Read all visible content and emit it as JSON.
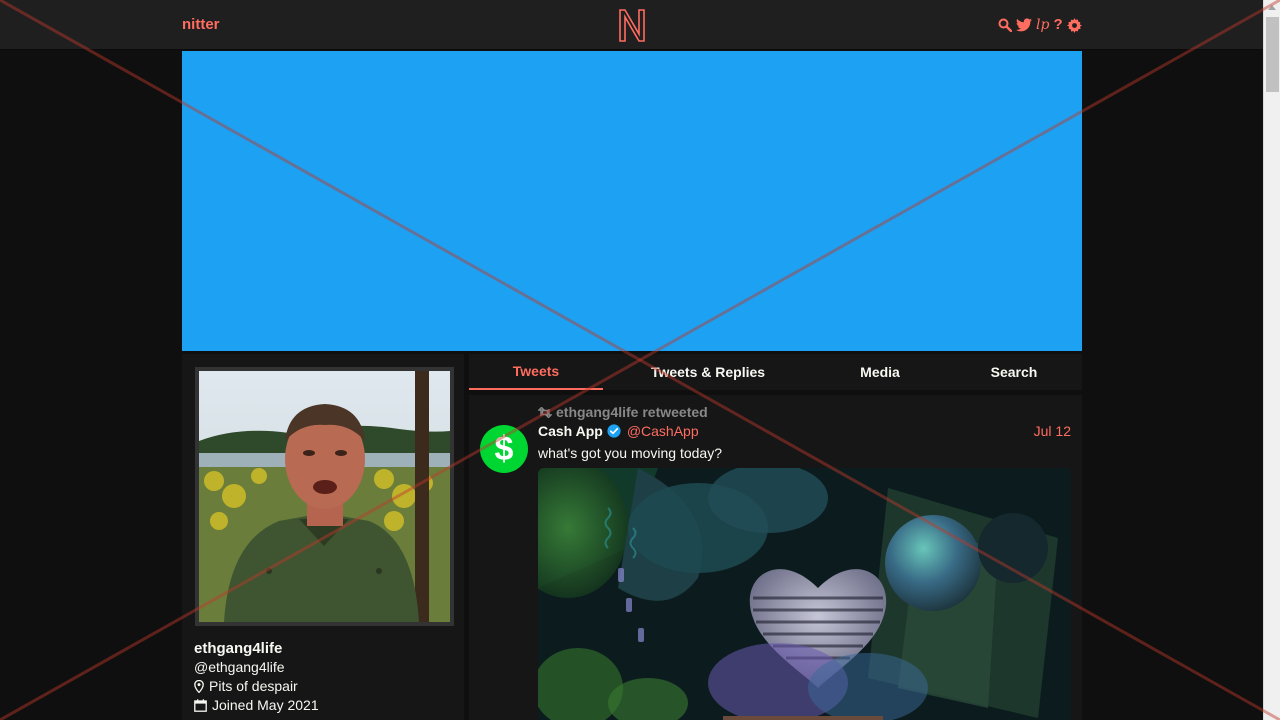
{
  "nav": {
    "brand": "nitter",
    "icons": [
      "search-icon",
      "twitter-bird-icon",
      "lp-icon",
      "help-icon",
      "gear-icon"
    ],
    "help_label": "?",
    "lp_label": "lp",
    "accent": "#ff6c60"
  },
  "banner": {
    "color": "#1da1f2"
  },
  "profile": {
    "fullname": "ethgang4life",
    "username": "@ethgang4life",
    "location": "Pits of despair",
    "joined": "Joined May 2021"
  },
  "tabs": [
    {
      "label": "Tweets",
      "active": true
    },
    {
      "label": "Tweets & Replies",
      "active": false
    },
    {
      "label": "Media",
      "active": false
    },
    {
      "label": "Search",
      "active": false
    }
  ],
  "timeline": {
    "tweet": {
      "retweet_header": "ethgang4life retweeted",
      "fullname": "Cash App",
      "verified": true,
      "username": "@CashApp",
      "date": "Jul 12",
      "content": "what's got you moving today?",
      "avatar_color": "#00d632",
      "avatar_symbol": "$"
    }
  }
}
